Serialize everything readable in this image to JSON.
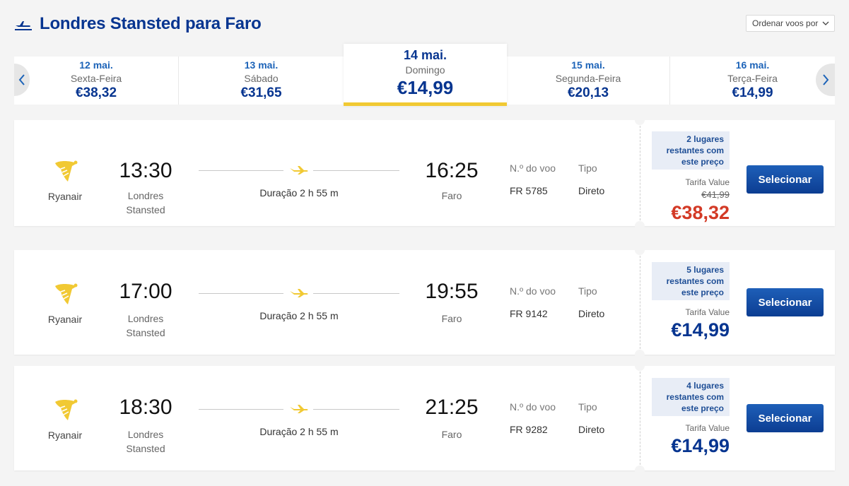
{
  "header": {
    "title": "Londres Stansted para Faro",
    "sort_label": "Ordenar voos por"
  },
  "dates": [
    {
      "date": "12 mai.",
      "weekday": "Sexta-Feira",
      "price": "€38,32"
    },
    {
      "date": "13 mai.",
      "weekday": "Sábado",
      "price": "€31,65"
    },
    {
      "date": "14 mai.",
      "weekday": "Domingo",
      "price": "€14,99",
      "selected": true
    },
    {
      "date": "15 mai.",
      "weekday": "Segunda-Feira",
      "price": "€20,13"
    },
    {
      "date": "16 mai.",
      "weekday": "Terça-Feira",
      "price": "€14,99"
    }
  ],
  "labels": {
    "flight_no": "N.º do voo",
    "type": "Tipo",
    "select": "Selecionar",
    "fare": "Tarifa Value"
  },
  "flights": [
    {
      "airline": "Ryanair",
      "dep_time": "13:30",
      "dep_city_1": "Londres",
      "dep_city_2": "Stansted",
      "duration": "Duração 2 h 55 m",
      "arr_time": "16:25",
      "arr_city": "Faro",
      "flight_no": "FR 5785",
      "type": "Direto",
      "seats_1": "2 lugares",
      "seats_2": "restantes com",
      "seats_3": "este preço",
      "old_price": "€41,99",
      "price": "€38,32"
    },
    {
      "airline": "Ryanair",
      "dep_time": "17:00",
      "dep_city_1": "Londres",
      "dep_city_2": "Stansted",
      "duration": "Duração 2 h 55 m",
      "arr_time": "19:55",
      "arr_city": "Faro",
      "flight_no": "FR 9142",
      "type": "Direto",
      "seats_1": "5 lugares",
      "seats_2": "restantes com",
      "seats_3": "este preço",
      "price": "€14,99"
    },
    {
      "airline": "Ryanair",
      "dep_time": "18:30",
      "dep_city_1": "Londres",
      "dep_city_2": "Stansted",
      "duration": "Duração 2 h 55 m",
      "arr_time": "21:25",
      "arr_city": "Faro",
      "flight_no": "FR 9282",
      "type": "Direto",
      "seats_1": "4 lugares",
      "seats_2": "restantes com",
      "seats_3": "este preço",
      "price": "€14,99"
    }
  ],
  "colors": {
    "brand": "#073590",
    "accent": "#f1c933",
    "discount": "#d33a26"
  },
  "icons": {
    "header": "plane-takeoff-icon",
    "logo": "ryanair-harp-logo",
    "route": "plane-icon"
  }
}
